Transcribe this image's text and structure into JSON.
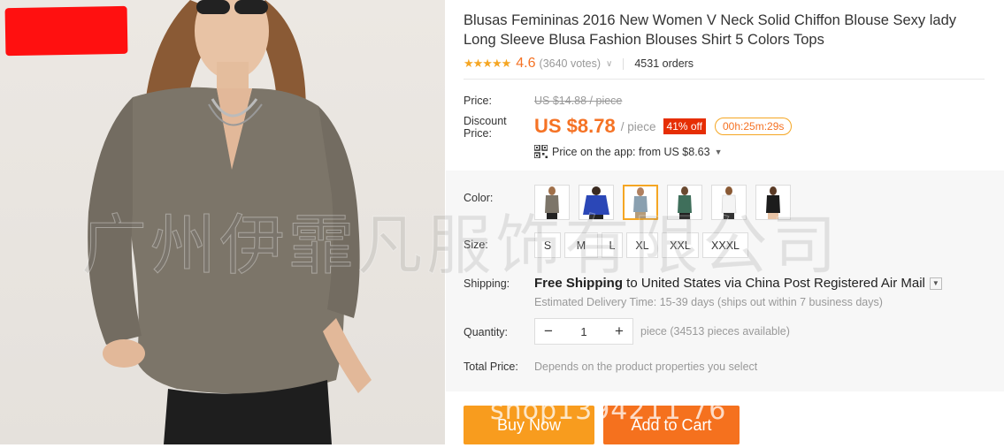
{
  "product": {
    "title": "Blusas Femininas 2016 New Women V Neck Solid Chiffon Blouse Sexy lady Long Sleeve Blusa Fashion Blouses Shirt 5 Colors Tops",
    "rating": "4.6",
    "stars": "★★★★★",
    "votes": "(3640 votes)",
    "orders": "4531 orders"
  },
  "pricing": {
    "price_label": "Price:",
    "old_price": "US $14.88 / piece",
    "discount_label": "Discount Price:",
    "price": "US $8.78",
    "per_unit": "/ piece",
    "discount_badge": "41% off",
    "countdown": "00h:25m:29s",
    "app_price": "Price on the app: from US $8.63",
    "app_caret": "▼"
  },
  "options": {
    "color_label": "Color:",
    "colors": [
      {
        "name": "gray",
        "hex": "#7c7569"
      },
      {
        "name": "blue",
        "hex": "#2b47b7"
      },
      {
        "name": "khaki",
        "hex": "#8a7a63"
      },
      {
        "name": "green",
        "hex": "#3f6f5b"
      },
      {
        "name": "white",
        "hex": "#f1f1f1"
      },
      {
        "name": "black",
        "hex": "#1c1c1c"
      }
    ],
    "selected_color_index": 2,
    "size_label": "Size:",
    "sizes": [
      "S",
      "M",
      "L",
      "XL",
      "XXL",
      "XXXL"
    ]
  },
  "shipping": {
    "label": "Shipping:",
    "prefix": "Free Shipping",
    "to": " to ",
    "country": "United States",
    "via": " via ",
    "carrier": "China Post Registered Air Mail",
    "delivery": "Estimated Delivery Time: 15-39 days (ships out within 7 business days)"
  },
  "quantity": {
    "label": "Quantity:",
    "value": "1",
    "minus": "−",
    "plus": "+",
    "available": "piece (34513 pieces available)"
  },
  "total": {
    "label": "Total Price:",
    "text": "Depends on the product properties you select"
  },
  "actions": {
    "buy_now": "Buy Now",
    "add_to_cart": "Add to Cart"
  },
  "watermarks": {
    "company": "广州伊霏凡服饰有限公司",
    "shop": "shop1394211 76"
  },
  "colors": {
    "accent": "#f57224",
    "buy_button": "#f89c1e",
    "cart_button": "#f5711e",
    "badge": "#e62e04"
  }
}
